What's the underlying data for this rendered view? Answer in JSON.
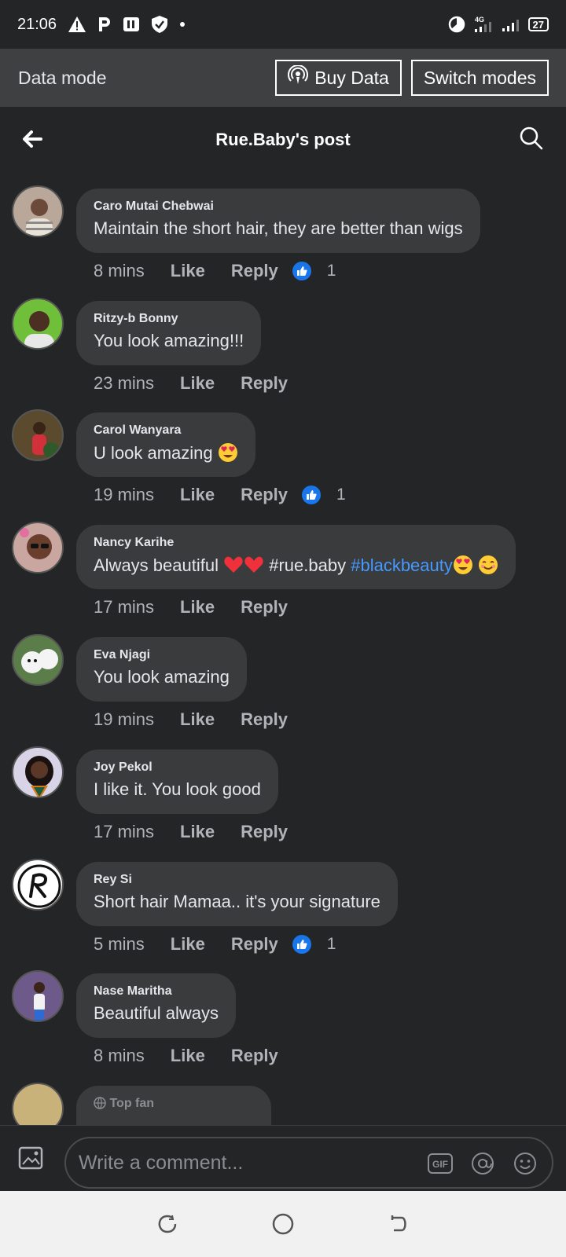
{
  "status_bar": {
    "time": "21:06",
    "battery": "27"
  },
  "data_mode": {
    "label": "Data mode",
    "buy_data": "Buy Data",
    "switch_modes": "Switch modes"
  },
  "header": {
    "title": "Rue.Baby's post"
  },
  "comments": [
    {
      "author": "Caro Mutai Chebwai",
      "text": "Maintain the short hair, they are better than wigs",
      "time": "8 mins",
      "like": "Like",
      "reply": "Reply",
      "reactions": "1",
      "avatar_color": "#b9a89a"
    },
    {
      "author": "Ritzy-b Bonny",
      "text": "You look amazing!!!",
      "time": "23 mins",
      "like": "Like",
      "reply": "Reply",
      "avatar_color": "#6fbf3a"
    },
    {
      "author": "Carol Wanyara",
      "text": "U look amazing",
      "time": "19 mins",
      "like": "Like",
      "reply": "Reply",
      "reactions": "1",
      "avatar_color": "#5c4a2e"
    },
    {
      "author": "Nancy Karihe",
      "text_part1": "Always beautiful",
      "text_part2": "#rue.baby",
      "hashtag": "#blackbeauty",
      "time": "17 mins",
      "like": "Like",
      "reply": "Reply",
      "avatar_color": "#c9a6a0"
    },
    {
      "author": "Eva Njagi",
      "text": "You look amazing",
      "time": "19 mins",
      "like": "Like",
      "reply": "Reply",
      "avatar_color": "#5a7d4a"
    },
    {
      "author": "Joy Pekol",
      "text": "I like it. You look good",
      "time": "17 mins",
      "like": "Like",
      "reply": "Reply",
      "avatar_color": "#d9d3e8"
    },
    {
      "author": "Rey Si",
      "text": "Short hair Mamaa.. it's your signature",
      "time": "5 mins",
      "like": "Like",
      "reply": "Reply",
      "reactions": "1",
      "avatar_color": "#ffffff"
    },
    {
      "author": "Nase Maritha",
      "text": "Beautiful always",
      "time": "8 mins",
      "like": "Like",
      "reply": "Reply",
      "avatar_color": "#6e5a8a"
    },
    {
      "author": "Top fan",
      "avatar_color": "#c9b27a"
    }
  ],
  "composer": {
    "placeholder": "Write a comment..."
  },
  "colors": {
    "background": "#242527",
    "bubble": "#3a3b3c",
    "hashtag": "#4599ff",
    "like_blue": "#1877f2"
  }
}
